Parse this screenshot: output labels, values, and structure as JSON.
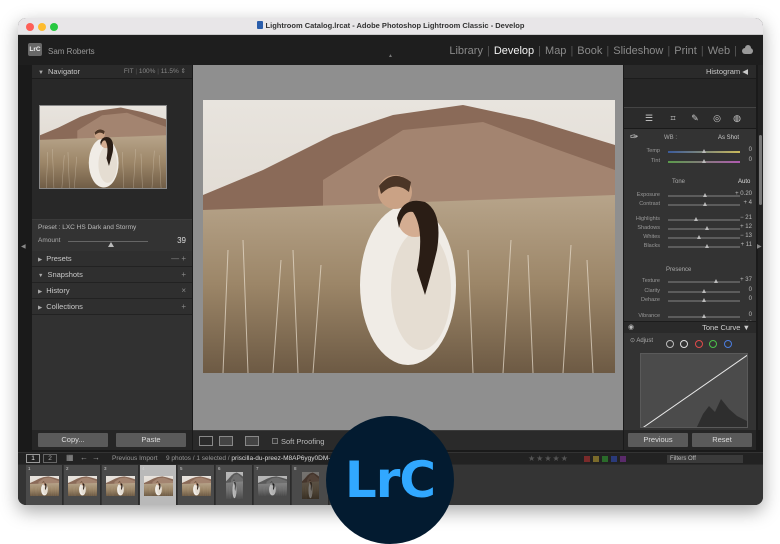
{
  "window": {
    "title": "Lightroom Catalog.lrcat - Adobe Photoshop Lightroom Classic - Develop"
  },
  "header": {
    "logo": "LrC",
    "user": "Sam Roberts",
    "modules": [
      "Library",
      "Develop",
      "Map",
      "Book",
      "Slideshow",
      "Print",
      "Web"
    ],
    "active_module": "Develop"
  },
  "left_panel": {
    "navigator": {
      "title": "Navigator",
      "zoom_fit": "FIT",
      "zoom_100": "100%",
      "zoom_other": "11.5%"
    },
    "preset": {
      "label": "Preset : LXC HS Dark and Stormy",
      "amount_label": "Amount",
      "amount_value": "39"
    },
    "sections": [
      {
        "label": "Presets",
        "right": "— +"
      },
      {
        "label": "Snapshots",
        "right": "+"
      },
      {
        "label": "History",
        "right": "×"
      },
      {
        "label": "Collections",
        "right": "+"
      }
    ],
    "copy_label": "Copy...",
    "paste_label": "Paste"
  },
  "toolbar": {
    "soft_proofing": "Soft Proofing"
  },
  "right_panel": {
    "histogram_title": "Histogram",
    "wb_label": "WB :",
    "wb_value": "As Shot",
    "tone_label": "Tone",
    "auto_label": "Auto",
    "presence_label": "Presence",
    "sliders": [
      {
        "label": "Temp",
        "value": "0",
        "pos": 0.5
      },
      {
        "label": "Tint",
        "value": "0",
        "pos": 0.5
      },
      {
        "label": "Exposure",
        "value": "+ 0.20",
        "pos": 0.52
      },
      {
        "label": "Contrast",
        "value": "+ 4",
        "pos": 0.52
      },
      {
        "label": "Highlights",
        "value": "− 21",
        "pos": 0.4
      },
      {
        "label": "Shadows",
        "value": "+ 12",
        "pos": 0.55
      },
      {
        "label": "Whites",
        "value": "− 13",
        "pos": 0.44
      },
      {
        "label": "Blacks",
        "value": "+ 11",
        "pos": 0.55
      },
      {
        "label": "Texture",
        "value": "+ 37",
        "pos": 0.68
      },
      {
        "label": "Clarity",
        "value": "0",
        "pos": 0.5
      },
      {
        "label": "Dehaze",
        "value": "0",
        "pos": 0.5
      },
      {
        "label": "Vibrance",
        "value": "0",
        "pos": 0.5
      },
      {
        "label": "Saturation",
        "value": "− 14",
        "pos": 0.43
      }
    ],
    "tone_curve_title": "Tone Curve",
    "adjust_label": "Adjust",
    "previous_label": "Previous",
    "reset_label": "Reset"
  },
  "filmstrip_bar": {
    "view1": "1",
    "view2": "2",
    "source": "Previous Import",
    "count": "9 photos / 1 selected /",
    "filename": "priscilla-du-preez-M8AP6ygy0DM-unsplash",
    "filters_label": "Filters Off"
  },
  "filmstrip": {
    "indices": [
      "1",
      "2",
      "3",
      "4",
      "5",
      "6",
      "7",
      "8",
      "9"
    ],
    "selected_index": "4"
  },
  "badge": {
    "text": "LrC"
  },
  "colors": {
    "accent": "#31a8ff",
    "badge_bg": "#031b30",
    "panel": "#313131"
  }
}
